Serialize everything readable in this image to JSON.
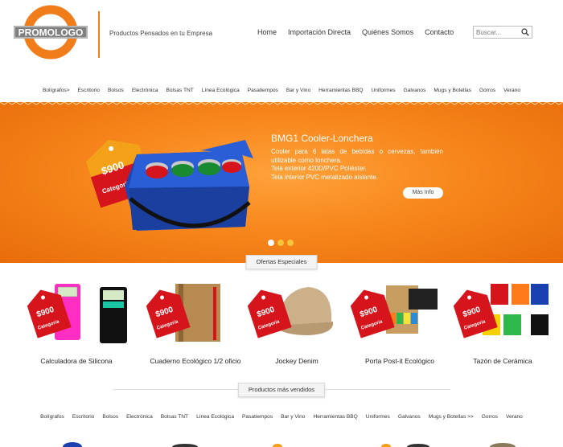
{
  "header": {
    "logo_text": "PROMOLOGO",
    "tagline": "Productos Pensados en tu Empresa",
    "nav": [
      "Home",
      "Importación Directa",
      "Quiénes Somos",
      "Contacto"
    ],
    "search_placeholder": "Buscar..."
  },
  "categories_top": [
    "Bolígrafos>",
    "Escritorio",
    "Bolsos",
    "Electrónica",
    "Bolsas TNT",
    "Línea Ecológica",
    "Pasatiempos",
    "Bar y Vino",
    "Herramientas BBQ",
    "Uniformes",
    "Galvanos",
    "Mugs y Botellas",
    "Gorros",
    "Verano"
  ],
  "banner": {
    "price": "$900",
    "tag_label": "Categoria",
    "title": "BMG1 Cooler-Lonchera",
    "desc_line1": "Cooler para 6 latas de bebidas o cervezas, también utilizable como lonchera.",
    "desc_line2": "Tela exterior 420D/PVC Poliéster.",
    "desc_line3": "Tela interior PVC metalizado aislante.",
    "button": "Más Info"
  },
  "section1": "Ofertas Especiales",
  "products": [
    {
      "name": "Calculadora de Silicona",
      "price": "$900",
      "tag": "Categoria"
    },
    {
      "name": "Cuaderno Ecológico 1/2 oficio",
      "price": "$900",
      "tag": "Categoria"
    },
    {
      "name": "Jockey Denim",
      "price": "$900",
      "tag": "Categoria"
    },
    {
      "name": "Porta Post-it Ecológico",
      "price": "$900",
      "tag": "Categoria"
    },
    {
      "name": "Tazón de Cerámica",
      "price": "$900",
      "tag": "Categoria"
    }
  ],
  "section2": "Productos más vendidos",
  "categories_bottom": [
    "Bolígrafos",
    "Escritorio",
    "Bolsos",
    "Electrónica",
    "Bolsas TNT",
    "Línea Ecológica",
    "Pasatiempos",
    "Bar y Vino",
    "Herramientas BBQ",
    "Uniformes",
    "Galvanos",
    "Mugs y Botellas >>",
    "Gorros",
    "Verano"
  ],
  "colors": {
    "brand_orange": "#f07c1a",
    "tag_red": "#c8102e",
    "banner": "#f7871c"
  }
}
